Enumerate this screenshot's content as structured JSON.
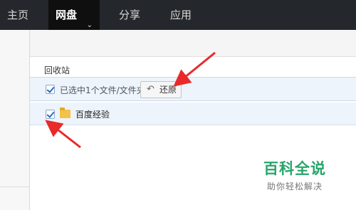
{
  "nav": {
    "items": [
      {
        "label": "主页"
      },
      {
        "label": "网盘"
      },
      {
        "label": "分享"
      },
      {
        "label": "应用"
      }
    ]
  },
  "main": {
    "breadcrumb": "回收站",
    "selection_text": "已选中1个文件/文件夹",
    "restore_label": "还原",
    "files": [
      {
        "name": "百度经验"
      }
    ]
  },
  "watermark": {
    "title": "百科全说",
    "subtitle": "助你轻松解决"
  },
  "colors": {
    "nav_bg": "#24272b",
    "selection_bg": "#edf4fc",
    "annotation_arrow": "#e82a2a",
    "watermark_green": "#27a56b"
  }
}
